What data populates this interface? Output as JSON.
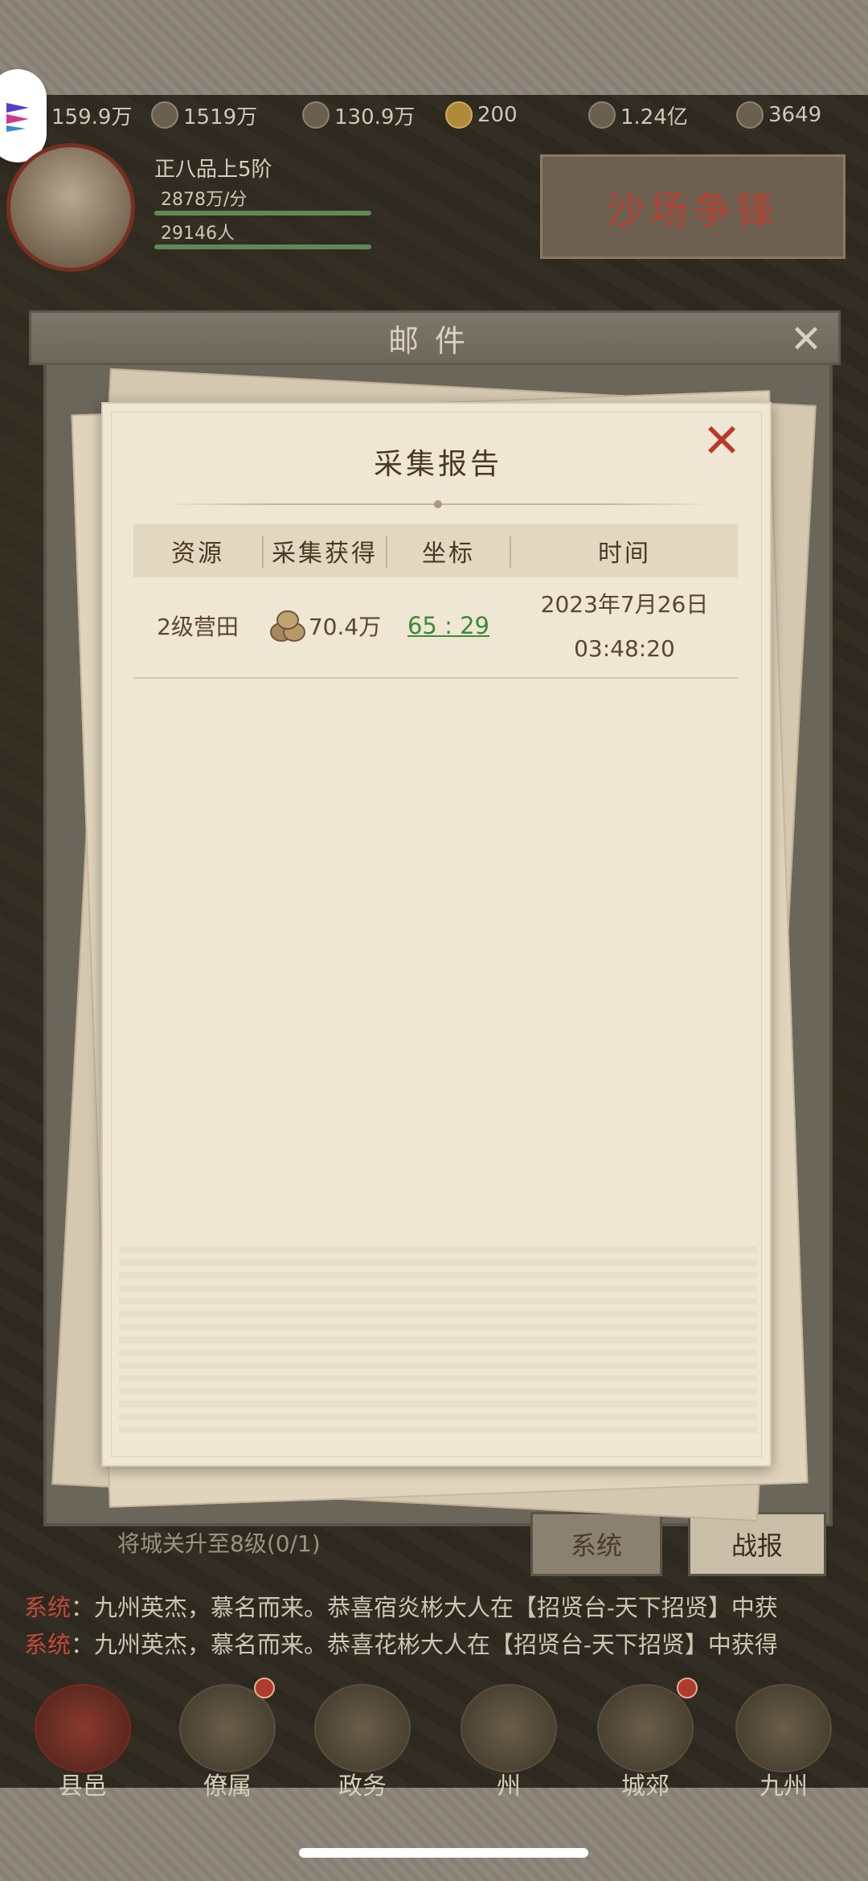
{
  "resources": [
    {
      "icon": "silver-icon",
      "value": "159.9万"
    },
    {
      "icon": "wood-icon",
      "value": "1519万"
    },
    {
      "icon": "grain-icon",
      "value": "130.9万"
    },
    {
      "icon": "gold-coin-icon",
      "value": "200"
    },
    {
      "icon": "copper-coin-icon",
      "value": "1.24亿"
    },
    {
      "icon": "ingot-icon",
      "value": "3649"
    }
  ],
  "player": {
    "rank": "正八品上5阶",
    "rate": "2878万/分",
    "population": "29146人"
  },
  "event_banner": "沙场争锋",
  "mail": {
    "title": "邮件",
    "tabs": [
      "系统",
      "战报"
    ],
    "behind_text": "将城关升至8级(0/1)"
  },
  "report": {
    "title": "采集报告",
    "columns": [
      "资源",
      "采集获得",
      "坐标",
      "时间"
    ],
    "row": {
      "resource": "2级营田",
      "gain": "70.4万",
      "coord": "65 : 29",
      "date": "2023年7月26日",
      "time": "03:48:20"
    }
  },
  "chat": [
    {
      "tag": "系统",
      "text": "：九州英杰，慕名而来。恭喜宿炎彬大人在【招贤台-天下招贤】中获"
    },
    {
      "tag": "系统",
      "text": "：九州英杰，慕名而来。恭喜花彬大人在【招贤台-天下招贤】中获得"
    }
  ],
  "nav": [
    "县邑",
    "僚属",
    "政务",
    "州",
    "城郊",
    "九州"
  ]
}
